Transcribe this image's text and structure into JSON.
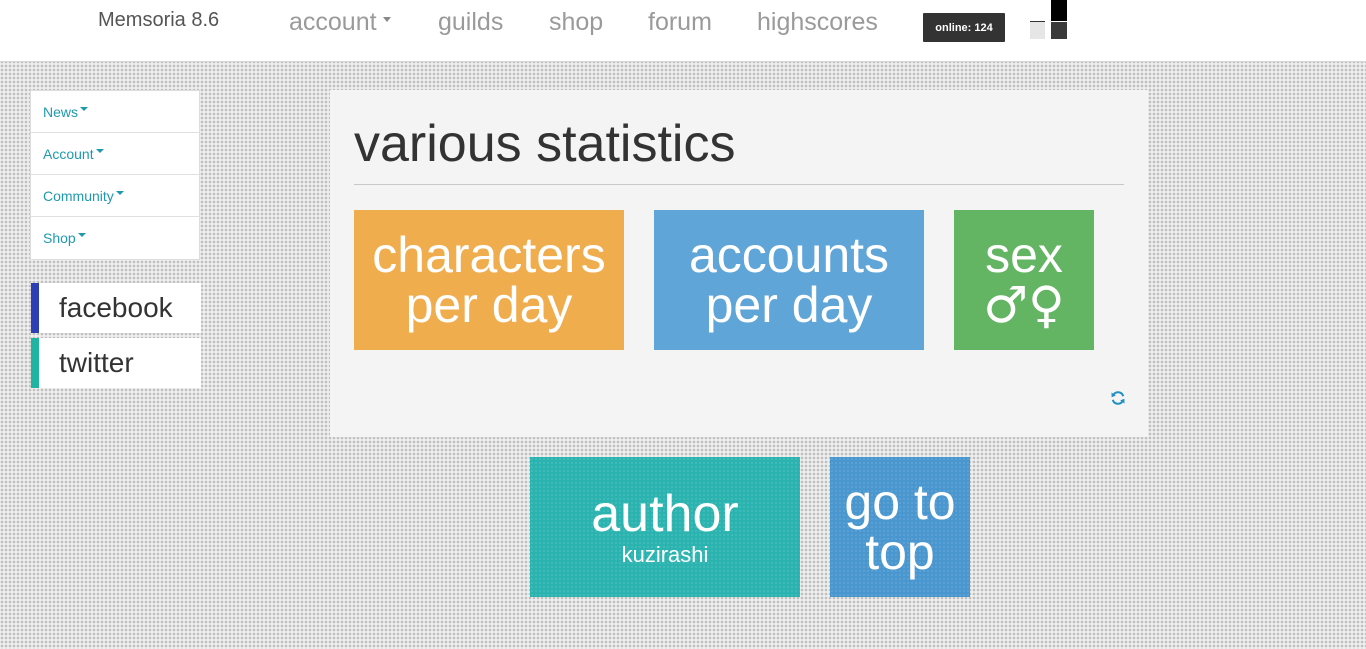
{
  "header": {
    "brand": "Memsoria 8.6",
    "nav": {
      "account": "account",
      "guilds": "guilds",
      "shop": "shop",
      "forum": "forum",
      "highscores": "highscores"
    },
    "online_badge": "online: 124"
  },
  "sidebar": {
    "items": [
      {
        "label": "News"
      },
      {
        "label": "Account"
      },
      {
        "label": "Community"
      },
      {
        "label": "Shop"
      }
    ],
    "social": {
      "facebook": {
        "label": "facebook",
        "color": "#2d3fb5"
      },
      "twitter": {
        "label": "twitter",
        "color": "#1fb3a1"
      }
    }
  },
  "main": {
    "title": "various statistics",
    "tiles": {
      "characters": {
        "line1": "characters",
        "line2": "per day",
        "color": "#f0ad4e"
      },
      "accounts": {
        "line1": "accounts",
        "line2": "per day",
        "color": "#5fa5d8"
      },
      "sex": {
        "line1": "sex",
        "symbols": "♂♀",
        "color": "#63b463"
      }
    },
    "refresh_icon": "refresh-icon"
  },
  "footer_tiles": {
    "author": {
      "title": "author",
      "name": "kuzirashi",
      "color": "#2bb3b0"
    },
    "go_to_top": {
      "line1": "go to",
      "line2": "top",
      "color": "#4a96cf"
    }
  }
}
